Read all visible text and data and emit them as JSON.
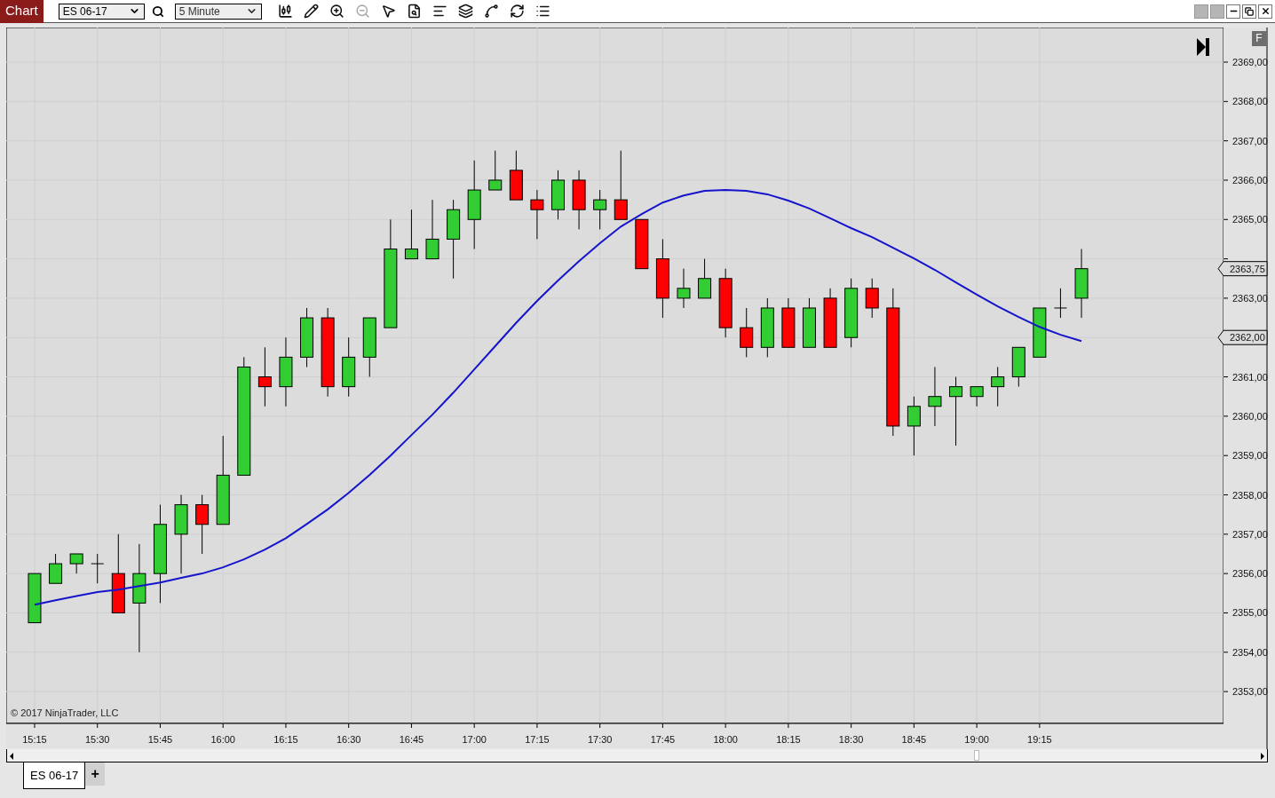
{
  "window": {
    "title": "Chart"
  },
  "toolbar": {
    "instrument": "ES 06-17",
    "interval": "5 Minute",
    "tools": [
      {
        "kind": "bars",
        "disabled": false
      },
      {
        "kind": "draw",
        "disabled": false
      },
      {
        "kind": "zoom_in",
        "disabled": false
      },
      {
        "kind": "zoom_out",
        "disabled": true
      },
      {
        "kind": "pointer",
        "disabled": false
      },
      {
        "kind": "data_box",
        "disabled": false
      },
      {
        "kind": "trader",
        "disabled": false
      },
      {
        "kind": "templates",
        "disabled": false
      },
      {
        "kind": "strategies",
        "disabled": false
      },
      {
        "kind": "reload",
        "disabled": false
      },
      {
        "kind": "properties",
        "disabled": false
      }
    ]
  },
  "chart": {
    "copyright": "© 2017 NinjaTrader, LLC",
    "fixed_scale_button": "F",
    "price_markers": [
      {
        "label": "2363,75"
      },
      {
        "label": "2362,00"
      }
    ],
    "chart_data": {
      "type": "candlestick",
      "x": [
        15.25,
        15.3333,
        15.4167,
        15.5,
        15.5833,
        15.6667,
        15.75,
        15.8333,
        15.9167,
        16.0,
        16.0833,
        16.1667,
        16.25,
        16.3333,
        16.4167,
        16.5,
        16.5833,
        16.6667,
        16.75,
        16.8333,
        16.9167,
        17.0,
        17.0833,
        17.1667,
        17.25,
        17.3333,
        17.4167,
        17.5,
        17.5833,
        17.6667,
        17.75,
        17.8333,
        17.9167,
        18.0,
        18.0833,
        18.1667,
        18.25,
        18.3333,
        18.4167,
        18.5,
        18.5833,
        18.6667,
        18.75,
        18.8333,
        18.9167,
        19.0,
        19.0833,
        19.1667,
        19.25,
        19.3333,
        19.4167
      ],
      "ohlc": [
        [
          2354.75,
          2356.0,
          2354.75,
          2356.0
        ],
        [
          2355.75,
          2356.5,
          2355.75,
          2356.25
        ],
        [
          2356.25,
          2356.5,
          2356.0,
          2356.5
        ],
        [
          2356.25,
          2356.5,
          2355.75,
          2356.25
        ],
        [
          2356.0,
          2357.0,
          2355.0,
          2355.0
        ],
        [
          2355.25,
          2356.75,
          2354.0,
          2356.0
        ],
        [
          2356.0,
          2357.75,
          2355.25,
          2357.25
        ],
        [
          2357.0,
          2358.0,
          2356.0,
          2357.75
        ],
        [
          2357.75,
          2358.0,
          2356.5,
          2357.25
        ],
        [
          2357.25,
          2359.5,
          2357.25,
          2358.5
        ],
        [
          2358.5,
          2361.5,
          2358.5,
          2361.25
        ],
        [
          2361.0,
          2361.75,
          2360.25,
          2360.75
        ],
        [
          2360.75,
          2362.0,
          2360.25,
          2361.5
        ],
        [
          2361.5,
          2362.75,
          2361.25,
          2362.5
        ],
        [
          2362.5,
          2362.75,
          2360.5,
          2360.75
        ],
        [
          2360.75,
          2362.0,
          2360.5,
          2361.5
        ],
        [
          2361.5,
          2362.5,
          2361.0,
          2362.5
        ],
        [
          2362.25,
          2365.0,
          2362.25,
          2364.25
        ],
        [
          2364.0,
          2365.25,
          2364.0,
          2364.25
        ],
        [
          2364.0,
          2365.5,
          2364.0,
          2364.5
        ],
        [
          2364.5,
          2365.5,
          2363.5,
          2365.25
        ],
        [
          2365.0,
          2366.5,
          2364.25,
          2365.75
        ],
        [
          2365.75,
          2366.75,
          2365.75,
          2366.0
        ],
        [
          2366.25,
          2366.75,
          2365.5,
          2365.5
        ],
        [
          2365.5,
          2365.75,
          2364.5,
          2365.25
        ],
        [
          2365.25,
          2366.25,
          2365.0,
          2366.0
        ],
        [
          2366.0,
          2366.25,
          2364.75,
          2365.25
        ],
        [
          2365.25,
          2365.75,
          2364.75,
          2365.5
        ],
        [
          2365.5,
          2366.75,
          2365.0,
          2365.0
        ],
        [
          2365.0,
          2365.0,
          2363.75,
          2363.75
        ],
        [
          2364.0,
          2364.5,
          2362.5,
          2363.0
        ],
        [
          2363.0,
          2363.75,
          2362.75,
          2363.25
        ],
        [
          2363.0,
          2364.0,
          2363.0,
          2363.5
        ],
        [
          2363.5,
          2363.75,
          2362.0,
          2362.25
        ],
        [
          2362.25,
          2362.75,
          2361.5,
          2361.75
        ],
        [
          2361.75,
          2363.0,
          2361.5,
          2362.75
        ],
        [
          2362.75,
          2363.0,
          2361.75,
          2361.75
        ],
        [
          2361.75,
          2363.0,
          2361.75,
          2362.75
        ],
        [
          2363.0,
          2363.25,
          2361.75,
          2361.75
        ],
        [
          2362.0,
          2363.5,
          2361.75,
          2363.25
        ],
        [
          2363.25,
          2363.5,
          2362.5,
          2362.75
        ],
        [
          2362.75,
          2363.25,
          2359.5,
          2359.75
        ],
        [
          2359.75,
          2360.5,
          2359.0,
          2360.25
        ],
        [
          2360.25,
          2361.25,
          2359.75,
          2360.5
        ],
        [
          2360.5,
          2361.0,
          2359.25,
          2360.75
        ],
        [
          2360.5,
          2360.75,
          2360.25,
          2360.75
        ],
        [
          2360.75,
          2361.25,
          2360.25,
          2361.0
        ],
        [
          2361.0,
          2361.75,
          2360.75,
          2361.75
        ],
        [
          2361.5,
          2362.75,
          2361.5,
          2362.75
        ],
        [
          2362.75,
          2363.25,
          2362.5,
          2362.75
        ],
        [
          2363.0,
          2364.25,
          2362.5,
          2363.75
        ]
      ],
      "series": [
        {
          "type": "line",
          "color": "#1414cc",
          "values": [
            2355.21,
            2355.32,
            2355.43,
            2355.53,
            2355.59,
            2355.68,
            2355.77,
            2355.89,
            2356.0,
            2356.16,
            2356.36,
            2356.61,
            2356.9,
            2357.26,
            2357.63,
            2358.05,
            2358.51,
            2359.0,
            2359.52,
            2360.04,
            2360.6,
            2361.19,
            2361.78,
            2362.37,
            2362.93,
            2363.45,
            2363.94,
            2364.4,
            2364.82,
            2365.14,
            2365.43,
            2365.61,
            2365.73,
            2365.75,
            2365.73,
            2365.64,
            2365.48,
            2365.28,
            2365.03,
            2364.78,
            2364.55,
            2364.28,
            2364.01,
            2363.72,
            2363.4,
            2363.09,
            2362.79,
            2362.52,
            2362.27,
            2362.07,
            2361.91
          ]
        }
      ],
      "xlim": [
        15.137,
        19.982
      ],
      "ylim": [
        2352.19,
        2369.88
      ],
      "grid": true,
      "xticks": [
        {
          "value": 15.25,
          "label": "15:15"
        },
        {
          "value": 15.5,
          "label": "15:30"
        },
        {
          "value": 15.75,
          "label": "15:45"
        },
        {
          "value": 16.0,
          "label": "16:00"
        },
        {
          "value": 16.25,
          "label": "16:15"
        },
        {
          "value": 16.5,
          "label": "16:30"
        },
        {
          "value": 16.75,
          "label": "16:45"
        },
        {
          "value": 17.0,
          "label": "17:00"
        },
        {
          "value": 17.25,
          "label": "17:15"
        },
        {
          "value": 17.5,
          "label": "17:30"
        },
        {
          "value": 17.75,
          "label": "17:45"
        },
        {
          "value": 18.0,
          "label": "18:00"
        },
        {
          "value": 18.25,
          "label": "18:15"
        },
        {
          "value": 18.5,
          "label": "18:30"
        },
        {
          "value": 18.75,
          "label": "18:45"
        },
        {
          "value": 19.0,
          "label": "19:00"
        },
        {
          "value": 19.25,
          "label": "19:15"
        }
      ],
      "yticks": [
        {
          "value": 2369,
          "label": "2369,00"
        },
        {
          "value": 2368,
          "label": "2368,00"
        },
        {
          "value": 2367,
          "label": "2367,00"
        },
        {
          "value": 2366,
          "label": "2366,00"
        },
        {
          "value": 2365,
          "label": "2365,00"
        },
        {
          "value": 2363,
          "label": "2363,00"
        },
        {
          "value": 2361,
          "label": "2361,00"
        },
        {
          "value": 2360,
          "label": "2360,00"
        },
        {
          "value": 2359,
          "label": "2359,00"
        },
        {
          "value": 2358,
          "label": "2358,00"
        },
        {
          "value": 2357,
          "label": "2357,00"
        },
        {
          "value": 2356,
          "label": "2356,00"
        },
        {
          "value": 2355,
          "label": "2355,00"
        },
        {
          "value": 2354,
          "label": "2354,00"
        },
        {
          "value": 2353,
          "label": "2353,00"
        }
      ]
    }
  },
  "tabs": [
    {
      "label": "ES 06-17",
      "selected": true
    }
  ],
  "add_tab": "+"
}
